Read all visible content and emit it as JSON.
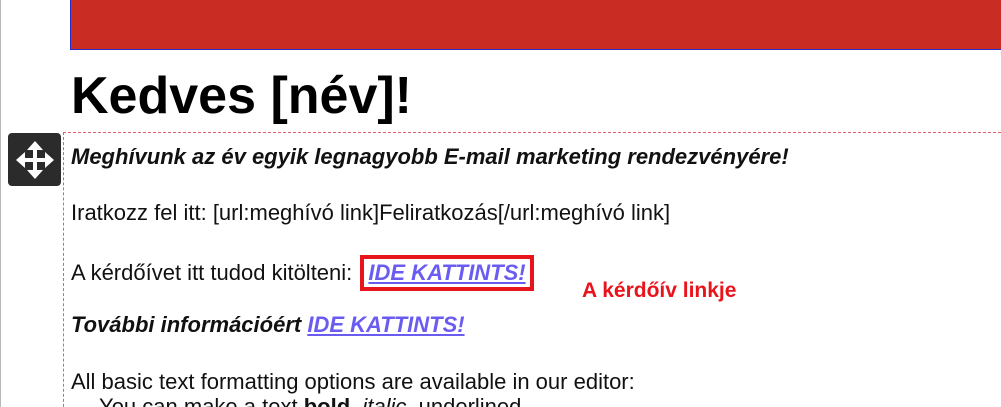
{
  "header": {
    "banner_color": "#c92c22"
  },
  "email": {
    "greeting": "Kedves [név]!",
    "invitation": "Meghívunk az év egyik legnagyobb E-mail marketing rendezvényére!",
    "signup_line": "Iratkozz fel itt: [url:meghívó link]Feliratkozás[/url:meghívó link]",
    "survey_prefix": "A kérdőívet itt tudod kitölteni: ",
    "survey_link": "IDE KATTINTS!",
    "more_info_prefix": "További információért ",
    "more_info_link": "IDE KATTINTS!",
    "formatting_intro": "All basic text formatting options are available in our editor:",
    "formatting_prefix": "- You can make a text ",
    "formatting_bold": "bold",
    "formatting_sep1": ", ",
    "formatting_italic": "italic",
    "formatting_sep2": ", ",
    "formatting_underlined": "underlined"
  },
  "annotation": {
    "label": "A kérdőív linkje",
    "color": "#e8141c"
  },
  "icons": {
    "move_handle": "move-arrows-icon"
  }
}
